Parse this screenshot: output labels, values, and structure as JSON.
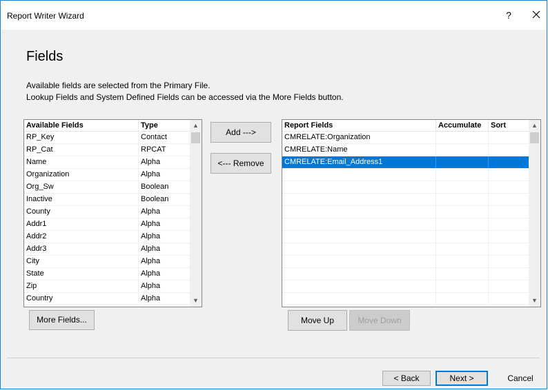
{
  "window": {
    "title": "Report Writer Wizard",
    "help_label": "?",
    "close_icon": "close-icon"
  },
  "page": {
    "title": "Fields",
    "desc1": "Available fields are selected from the Primary File.",
    "desc2": "Lookup Fields and System Defined Fields can be accessed via the More Fields button."
  },
  "available": {
    "headers": [
      "Available Fields",
      "Type"
    ],
    "rows": [
      [
        "RP_Key",
        "Contact"
      ],
      [
        "RP_Cat",
        "RPCAT"
      ],
      [
        "Name",
        "Alpha"
      ],
      [
        "Organization",
        "Alpha"
      ],
      [
        "Org_Sw",
        "Boolean"
      ],
      [
        "Inactive",
        "Boolean"
      ],
      [
        "County",
        "Alpha"
      ],
      [
        "Addr1",
        "Alpha"
      ],
      [
        "Addr2",
        "Alpha"
      ],
      [
        "Addr3",
        "Alpha"
      ],
      [
        "City",
        "Alpha"
      ],
      [
        "State",
        "Alpha"
      ],
      [
        "Zip",
        "Alpha"
      ],
      [
        "Country",
        "Alpha"
      ]
    ]
  },
  "report": {
    "headers": [
      "Report Fields",
      "Accumulate",
      "Sort"
    ],
    "rows": [
      [
        "CMRELATE:Organization",
        "",
        ""
      ],
      [
        "CMRELATE:Name",
        "",
        ""
      ],
      [
        "CMRELATE:Email_Address1",
        "",
        ""
      ]
    ],
    "selected_index": 2,
    "empty_rows": 11
  },
  "buttons": {
    "add": "Add --->",
    "remove": "<--- Remove",
    "more_fields": "More Fields...",
    "move_up": "Move Up",
    "move_down": "Move Down",
    "back": "< Back",
    "next": "Next >",
    "cancel": "Cancel"
  }
}
